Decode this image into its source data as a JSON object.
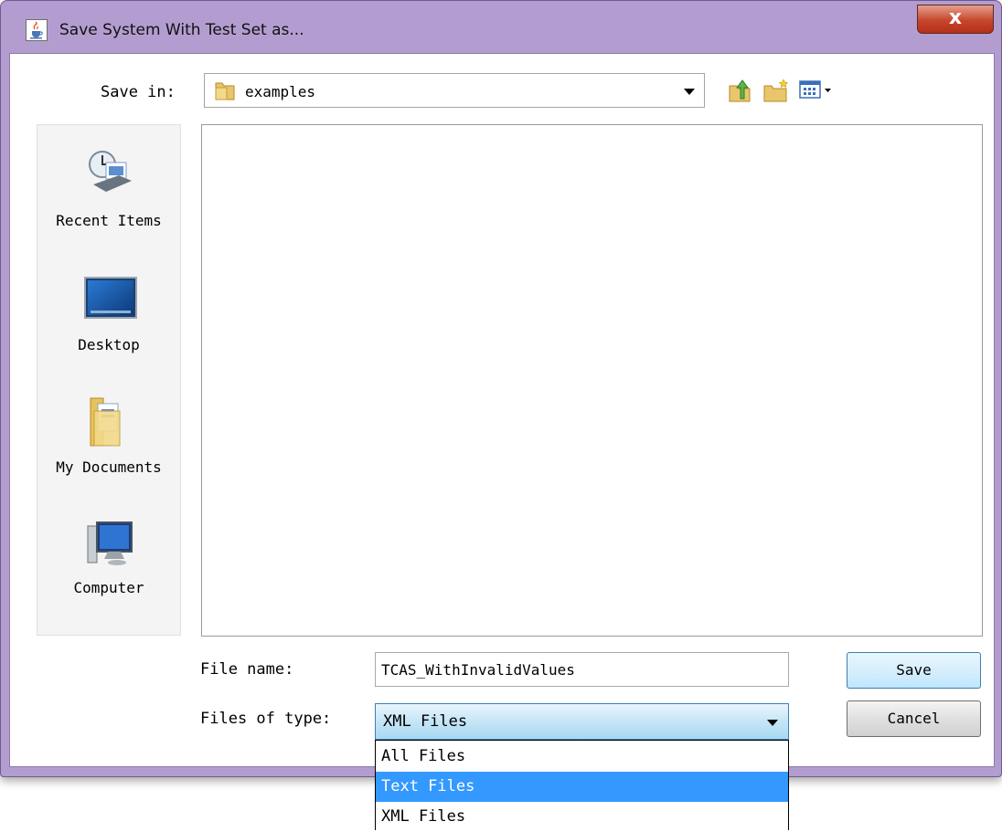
{
  "window": {
    "title": "Save System With Test Set as...",
    "close_label": "x",
    "icon": "java-cup-icon"
  },
  "save_in": {
    "label": "Save in:",
    "value": "examples",
    "icon": "folder-icon"
  },
  "toolbar": {
    "up_icon": "up-one-level-icon",
    "new_folder_icon": "new-folder-icon",
    "view_menu_icon": "view-menu-icon"
  },
  "places": [
    {
      "label": "Recent Items",
      "icon": "recent-items-icon"
    },
    {
      "label": "Desktop",
      "icon": "desktop-icon"
    },
    {
      "label": "My Documents",
      "icon": "my-documents-icon"
    },
    {
      "label": "Computer",
      "icon": "computer-icon"
    }
  ],
  "file_name": {
    "label": "File name:",
    "value": "TCAS_WithInvalidValues"
  },
  "files_of_type": {
    "label": "Files of type:",
    "value": "XML Files",
    "options": [
      "All Files",
      "Text Files",
      "XML Files"
    ],
    "highlighted": "Text Files"
  },
  "buttons": {
    "save": "Save",
    "cancel": "Cancel"
  },
  "colors": {
    "frame": "#b39dd0",
    "selection": "#3399ff",
    "close": "#c7462c"
  }
}
